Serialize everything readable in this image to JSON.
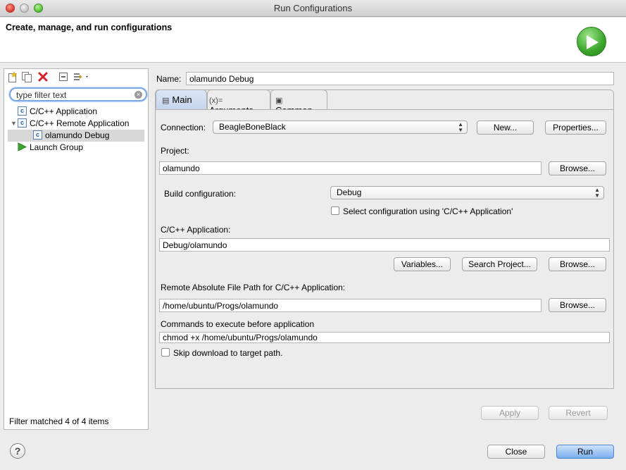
{
  "window": {
    "title": "Run Configurations"
  },
  "banner": {
    "title": "Create, manage, and run configurations"
  },
  "left_panel": {
    "filter_placeholder": "type filter text",
    "tree": [
      {
        "label": "C/C++ Application",
        "icon": "c-config-icon"
      },
      {
        "label": "C/C++ Remote Application",
        "icon": "c-config-icon"
      },
      {
        "label": "olamundo Debug",
        "icon": "c-config-icon"
      },
      {
        "label": "Launch Group",
        "icon": "launch-group-icon"
      }
    ],
    "status": "Filter matched 4 of 4 items"
  },
  "config": {
    "name_label": "Name:",
    "name_value": "olamundo Debug"
  },
  "tabs": [
    {
      "label": "Main",
      "icon": "main-tab-icon"
    },
    {
      "label": "Arguments",
      "icon": "arguments-tab-icon"
    },
    {
      "label": "Common",
      "icon": "common-tab-icon"
    }
  ],
  "main": {
    "connection_label": "Connection:",
    "connection_value": "BeagleBoneBlack",
    "new_label": "New...",
    "properties_label": "Properties...",
    "project_label": "Project:",
    "project_value": "olamundo",
    "browse_label": "Browse...",
    "build_config_label": "Build configuration:",
    "build_config_value": "Debug",
    "select_config_label": "Select configuration using 'C/C++ Application'",
    "app_label": "C/C++ Application:",
    "app_value": "Debug/olamundo",
    "variables_label": "Variables...",
    "search_project_label": "Search Project...",
    "remote_path_label": "Remote Absolute File Path for C/C++ Application:",
    "remote_path_value": "/home/ubuntu/Progs/olamundo",
    "commands_label": "Commands to execute before application",
    "commands_value": "chmod +x /home/ubuntu/Progs/olamundo",
    "skip_download_label": "Skip download to target path."
  },
  "footer": {
    "apply_label": "Apply",
    "revert_label": "Revert",
    "close_label": "Close",
    "run_label": "Run",
    "help_glyph": "?"
  }
}
